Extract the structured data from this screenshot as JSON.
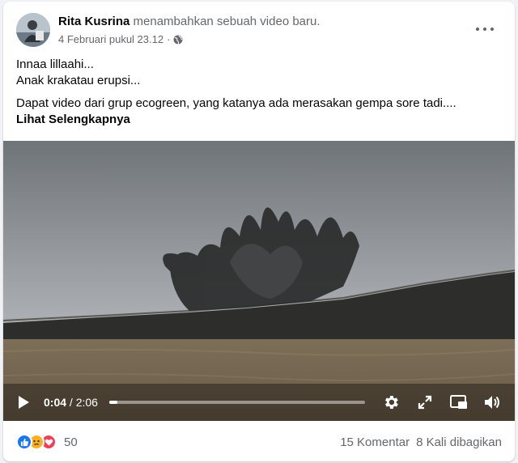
{
  "post": {
    "author": "Rita Kusrina",
    "action": "menambahkan sebuah video baru.",
    "timestamp": "4 Februari pukul 23.12",
    "audience_icon": "globe-icon",
    "lines": [
      "Innaa lillaahi...",
      "Anak krakatau erupsi...",
      "Dapat video dari grup ecogreen, yang katanya ada merasakan gempa sore tadi...."
    ],
    "see_more": "Lihat Selengkapnya"
  },
  "video": {
    "current_time": "0:04",
    "separator": "/",
    "duration": "2:06",
    "progress": 0.032,
    "icons": [
      "play-icon",
      "settings-gear-icon",
      "fullscreen-expand-icon",
      "picture-in-picture-icon",
      "volume-icon"
    ]
  },
  "footer": {
    "reactions": [
      "like-reaction-icon",
      "sad-reaction-icon",
      "love-reaction-icon"
    ],
    "reaction_count": "50",
    "comments": "15 Komentar",
    "shares": "8 Kali dibagikan"
  },
  "colors": {
    "primary_text": "#050505",
    "secondary_text": "#65676b",
    "like": "#1877f2",
    "love": "#f33e58",
    "sad": "#f7b125"
  }
}
